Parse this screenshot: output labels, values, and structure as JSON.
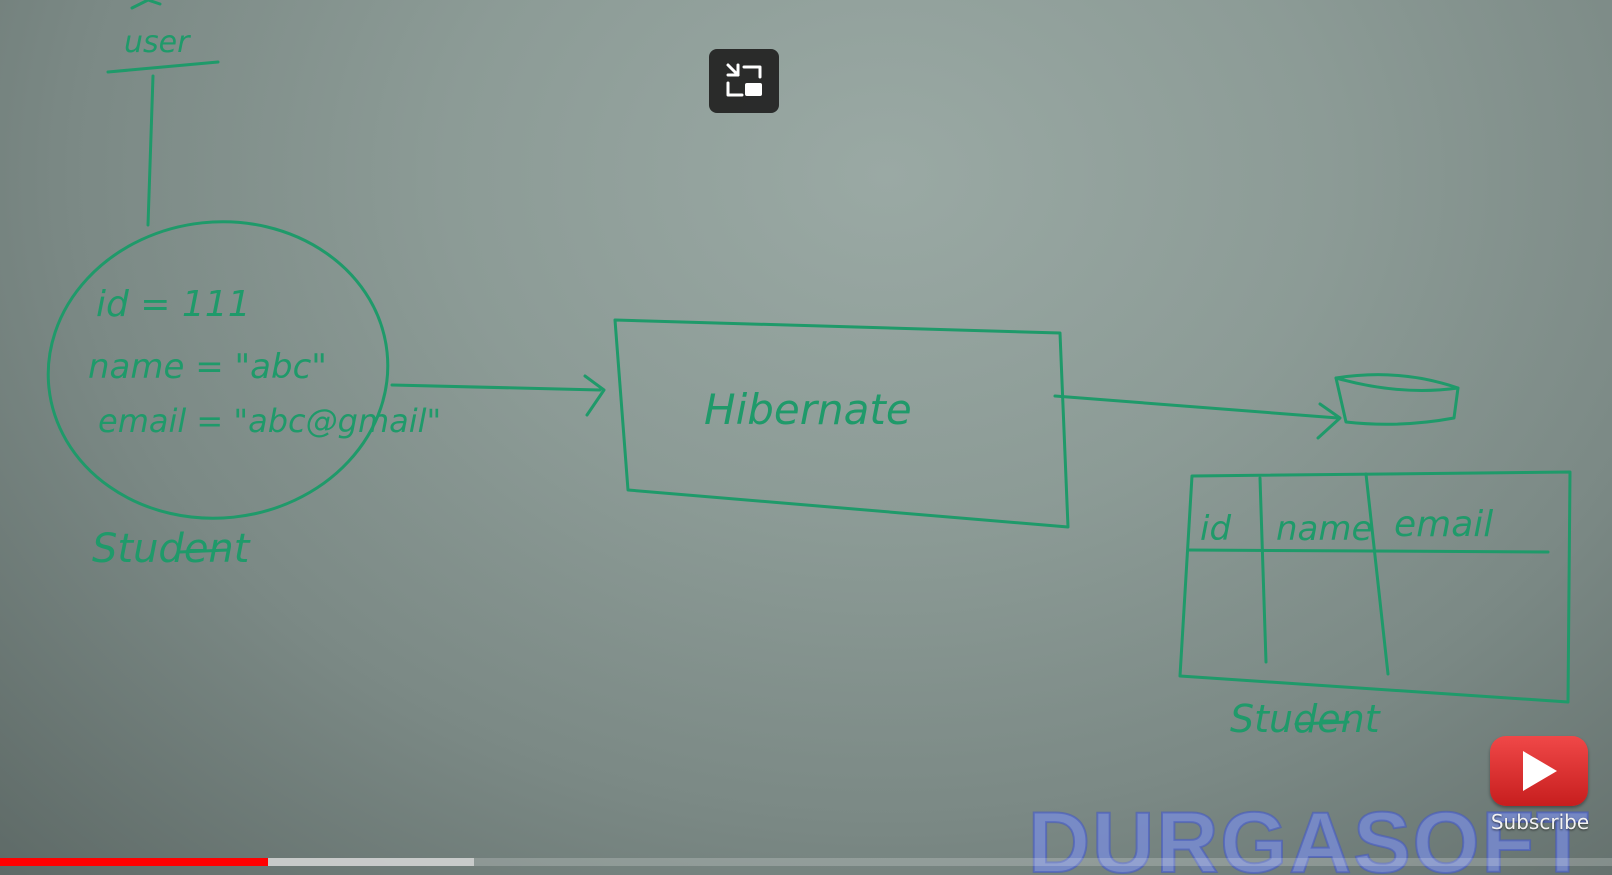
{
  "board": {
    "user_label": "user",
    "object_fields": [
      "id  = 111",
      "name = \"abc\"",
      "email = \"abc@gmail\""
    ],
    "object_caption": "Student",
    "middleware_label": "Hibernate",
    "table_columns": [
      "id",
      "name",
      "email"
    ],
    "table_caption": "Student",
    "ink_color": "#1f9a6a"
  },
  "controls": {
    "exit_fullscreen_icon": "exit-fullscreen-icon"
  },
  "watermark": {
    "text": "DURGASOFT"
  },
  "subscribe": {
    "label": "Subscribe",
    "icon": "play-icon"
  },
  "progress": {
    "played_fraction": 0.166,
    "buffered_fraction": 0.294
  }
}
